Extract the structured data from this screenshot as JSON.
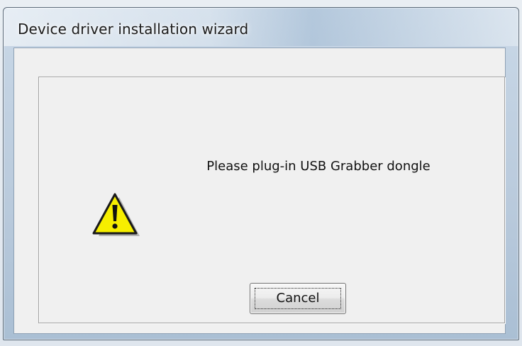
{
  "window": {
    "title": "Device driver installation wizard"
  },
  "dialog": {
    "message": "Please plug-in USB Grabber dongle",
    "icon": "warning-icon",
    "cancel_label": "Cancel"
  },
  "colors": {
    "warning_fill": "#f6ee00",
    "warning_outline": "#1a1a1a",
    "dialog_background": "#f0f0f0"
  }
}
